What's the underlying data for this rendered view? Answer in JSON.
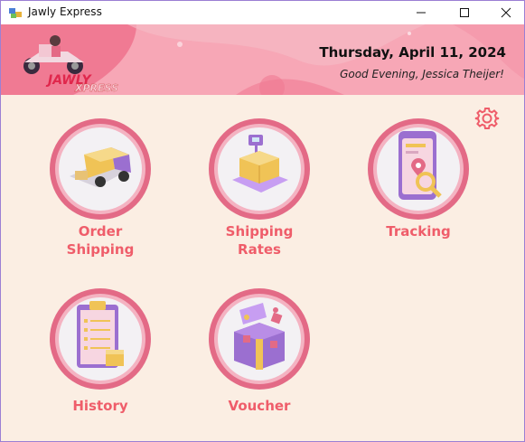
{
  "window": {
    "title": "Jawly Express"
  },
  "header": {
    "date": "Thursday, April 11, 2024",
    "greeting": "Good Evening, Jessica Theijer!",
    "logo_text": "JAWLY EXPRESS"
  },
  "menu": {
    "order_shipping": {
      "line1": "Order",
      "line2": "Shipping"
    },
    "shipping_rates": {
      "line1": "Shipping",
      "line2": "Rates"
    },
    "tracking": {
      "line1": "Tracking"
    },
    "history": {
      "line1": "History"
    },
    "voucher": {
      "line1": "Voucher"
    }
  },
  "icons": {
    "settings": "gear-icon",
    "minimize": "minimize-icon",
    "maximize": "maximize-icon",
    "close": "close-icon"
  },
  "colors": {
    "accent": "#ef5d6a",
    "banner": "#f6a3b3",
    "background": "#fbeee3",
    "ring": "#e36a86",
    "purple": "#9b6fd0",
    "gold": "#f0c356"
  }
}
